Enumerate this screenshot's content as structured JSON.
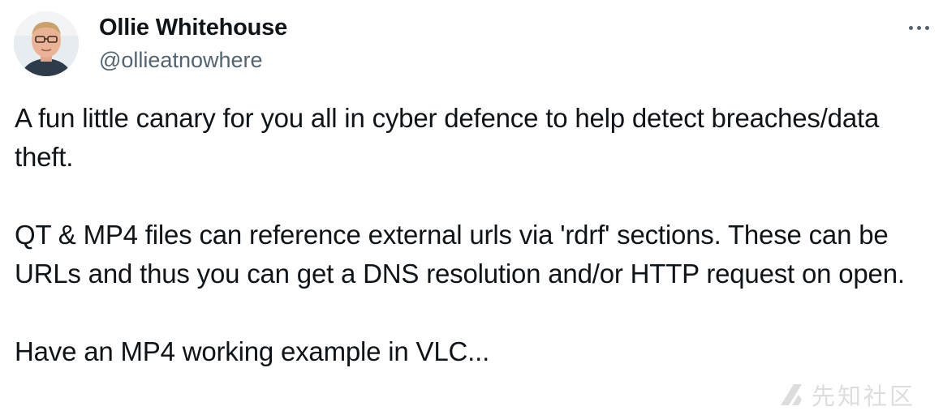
{
  "author": {
    "display_name": "Ollie Whitehouse",
    "handle": "@ollieatnowhere"
  },
  "tweet": {
    "paragraphs": [
      "A fun little canary for you all in cyber defence to help detect breaches/data theft.",
      "QT & MP4 files can reference external urls via 'rdrf' sections. These can be URLs and thus you can get a DNS resolution and/or HTTP request on open.",
      "Have an MP4 working example in VLC..."
    ]
  },
  "icons": {
    "more": "more-horizontal-icon",
    "watermark": "watermark-logo-icon"
  },
  "watermark": {
    "text": "先知社区"
  },
  "colors": {
    "text_primary": "#0f1419",
    "text_secondary": "#536471",
    "background": "#ffffff"
  }
}
